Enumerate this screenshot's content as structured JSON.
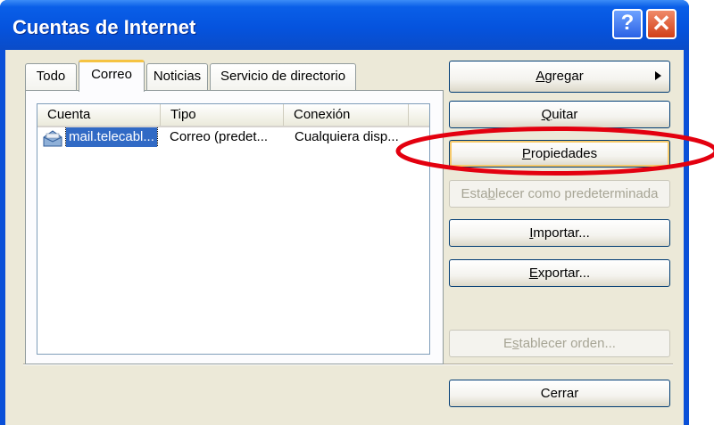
{
  "window": {
    "title": "Cuentas de Internet",
    "help_glyph": "?",
    "close_glyph": "✕"
  },
  "tabs": [
    {
      "label": "Todo"
    },
    {
      "label": "Correo"
    },
    {
      "label": "Noticias"
    },
    {
      "label": "Servicio de directorio"
    }
  ],
  "list": {
    "columns": [
      "Cuenta",
      "Tipo",
      "Conexión"
    ],
    "rows": [
      {
        "cuenta": "mail.telecabl...",
        "tipo": "Correo (predet...",
        "conexion": "Cualquiera disp..."
      }
    ]
  },
  "buttons": {
    "agregar": {
      "pre": "",
      "key": "A",
      "post": "gregar"
    },
    "quitar": {
      "pre": "",
      "key": "Q",
      "post": "uitar"
    },
    "propiedades": {
      "pre": "",
      "key": "P",
      "post": "ropiedades"
    },
    "predeterminada": {
      "pre": "Esta",
      "key": "b",
      "post": "lecer como predeterminada"
    },
    "importar": {
      "pre": "",
      "key": "I",
      "post": "mportar..."
    },
    "exportar": {
      "pre": "",
      "key": "E",
      "post": "xportar..."
    },
    "orden": {
      "pre": "E",
      "key": "s",
      "post": "tablecer orden..."
    },
    "cerrar": {
      "label": "Cerrar"
    }
  },
  "colors": {
    "annotation_red": "#e3000f",
    "titlebar_blue": "#0553de",
    "selection_blue": "#316ac5"
  },
  "icons": [
    "help-icon",
    "close-icon",
    "mail-account-icon",
    "submenu-arrow-icon"
  ]
}
